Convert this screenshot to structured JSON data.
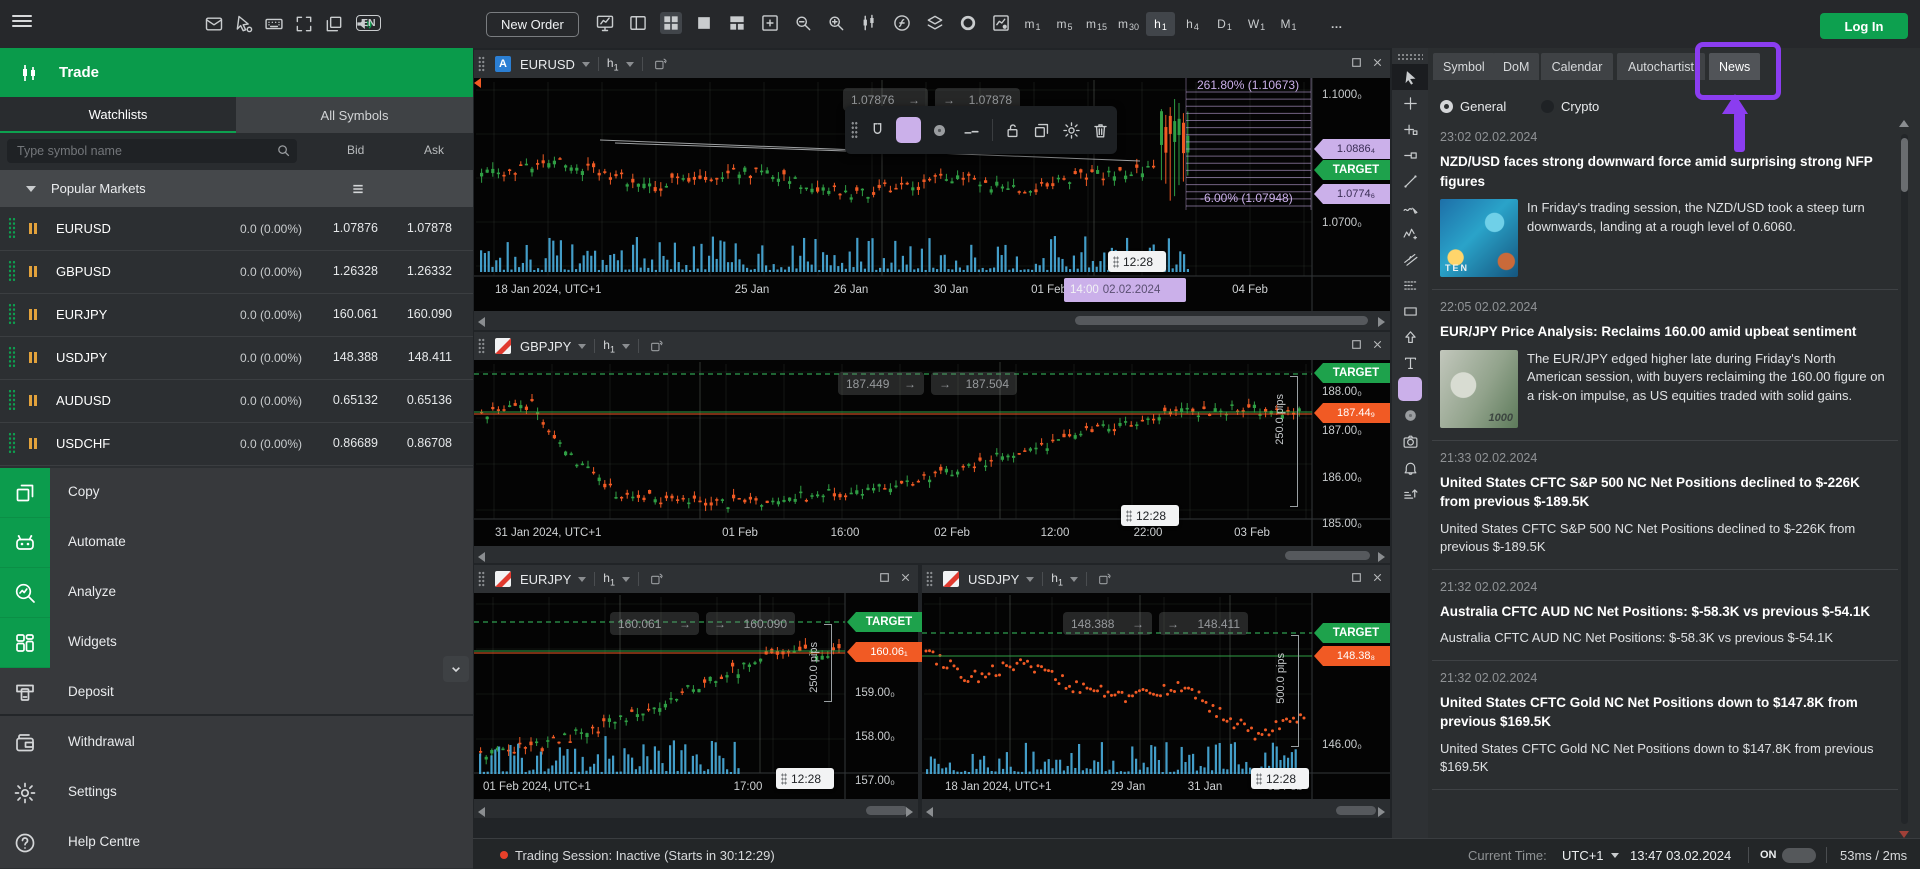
{
  "topbar": {
    "new_order_label": "New Order",
    "language": "EN",
    "login_label": "Log In",
    "more_label": "…",
    "timeframes": [
      {
        "u": "m",
        "s": "1"
      },
      {
        "u": "m",
        "s": "5"
      },
      {
        "u": "m",
        "s": "15"
      },
      {
        "u": "m",
        "s": "30"
      },
      {
        "u": "h",
        "s": "1"
      },
      {
        "u": "h",
        "s": "4"
      },
      {
        "u": "D",
        "s": "1"
      },
      {
        "u": "W",
        "s": "1"
      },
      {
        "u": "M",
        "s": "1"
      }
    ],
    "active_timeframe": "h1"
  },
  "sidebar": {
    "title": "Trade",
    "tab_watchlists": "Watchlists",
    "tab_all_symbols": "All Symbols",
    "search_placeholder": "Type symbol name",
    "col_bid": "Bid",
    "col_ask": "Ask",
    "group_label": "Popular Markets",
    "symbols": [
      {
        "name": "EURUSD",
        "change": "0.0 (0.00%)",
        "bid": "1.07876",
        "ask": "1.07878"
      },
      {
        "name": "GBPUSD",
        "change": "0.0 (0.00%)",
        "bid": "1.26328",
        "ask": "1.26332"
      },
      {
        "name": "EURJPY",
        "change": "0.0 (0.00%)",
        "bid": "160.061",
        "ask": "160.090"
      },
      {
        "name": "USDJPY",
        "change": "0.0 (0.00%)",
        "bid": "148.388",
        "ask": "148.411"
      },
      {
        "name": "AUDUSD",
        "change": "0.0 (0.00%)",
        "bid": "0.65132",
        "ask": "0.65136"
      },
      {
        "name": "USDCHF",
        "change": "0.0 (0.00%)",
        "bid": "0.86689",
        "ask": "0.86708"
      }
    ],
    "menu": [
      {
        "label": "Copy",
        "icon": "copy"
      },
      {
        "label": "Automate",
        "icon": "robot"
      },
      {
        "label": "Analyze",
        "icon": "analyze"
      },
      {
        "label": "Widgets",
        "icon": "widgets"
      }
    ],
    "secondary_menu": [
      {
        "label": "Deposit",
        "icon": "deposit"
      },
      {
        "label": "Withdrawal",
        "icon": "wallet"
      },
      {
        "label": "Settings",
        "icon": "settings"
      },
      {
        "label": "Help Centre",
        "icon": "help"
      }
    ]
  },
  "charts": [
    {
      "symbol": "EURUSD",
      "badge": "A",
      "tf_unit": "h",
      "tf_num": "1",
      "sell": "1.07876",
      "buy": "1.07878",
      "fib_top": "261.80% (1.10673)",
      "fib_bottom": "-6.00% (1.07948)",
      "axis_labels": [
        "1.1000₀",
        "1.0700₀"
      ],
      "tag_upper": "1.0886₄",
      "tag_target": "TARGET",
      "tag_lower": "1.0774₆",
      "time_ticks": [
        "18 Jan 2024, UTC+1",
        "25 Jan",
        "26 Jan",
        "30 Jan",
        "01 Feb",
        "14:00"
      ],
      "time_highlight": "02.02.2024",
      "time_tick_last": "04 Feb",
      "tooltip": "12:28"
    },
    {
      "symbol": "GBPJPY",
      "tf_unit": "h",
      "tf_num": "1",
      "sell": "187.449",
      "buy": "187.504",
      "axis_labels": [
        "188.00₀",
        "187.00₀",
        "186.00₀",
        "185.00₀"
      ],
      "tag_target": "TARGET",
      "tag_price": "187.44₉",
      "pips": "250.0 pips",
      "time_ticks": [
        "31 Jan 2024, UTC+1",
        "01 Feb",
        "16:00",
        "02 Feb",
        "12:00",
        "22:00",
        "03 Feb"
      ],
      "tooltip": "12:28"
    },
    {
      "symbol": "EURJPY",
      "tf_unit": "h",
      "tf_num": "1",
      "sell": "160.061",
      "buy": "160.090",
      "axis_labels": [
        "159.00₀",
        "158.00₀",
        "157.00₀"
      ],
      "tag_target": "TARGET",
      "tag_price": "160.06₁",
      "pips": "250.0 pips",
      "time_ticks": [
        "01 Feb 2024, UTC+1",
        "17:00"
      ],
      "tooltip": "12:28"
    },
    {
      "symbol": "USDJPY",
      "tf_unit": "h",
      "tf_num": "1",
      "sell": "148.388",
      "buy": "148.411",
      "axis_labels": [
        "146.00₀"
      ],
      "tag_target": "TARGET",
      "tag_price": "148.38₈",
      "pips": "500.0 pips",
      "time_ticks": [
        "18 Jan 2024, UTC+1",
        "29 Jan",
        "31 Jan",
        "02 Feb"
      ],
      "tooltip": "12:28"
    }
  ],
  "news": {
    "tabs": [
      {
        "label": "Symbol"
      },
      {
        "label": "DoM"
      },
      {
        "label": "Calendar"
      },
      {
        "label": "Autochartist"
      },
      {
        "label": "News"
      }
    ],
    "active_tab": "News",
    "filter_general": "General",
    "filter_crypto": "Crypto",
    "selected_filter": "General",
    "items": [
      {
        "time": "23:02 02.02.2024",
        "title": "NZD/USD faces strong downward force amid surprising strong NFP figures",
        "body": "In Friday's trading session, the NZD/USD took a steep turn downwards, landing at a rough level of 0.6060.",
        "thumb": "nzd-banknote",
        "thumb_text": "TEN"
      },
      {
        "time": "22:05 02.02.2024",
        "title": "EUR/JPY Price Analysis: Reclaims 160.00 amid upbeat sentiment",
        "body": "The EUR/JPY edged higher late during Friday's North American session, with buyers reclaiming the 160.00 figure on a risk-on impulse, as US equities traded with solid gains.",
        "thumb": "jpy-banknote",
        "thumb_text": "1000"
      },
      {
        "time": "21:33 02.02.2024",
        "title": "United States CFTC S&P 500 NC Net Positions declined to $-226K from previous $-189.5K",
        "body": "United States CFTC S&P 500 NC Net Positions declined to $-226K from previous $-189.5K"
      },
      {
        "time": "21:32 02.02.2024",
        "title": "Australia CFTC AUD NC Net Positions: $-58.3K vs previous $-54.1K",
        "body": "Australia CFTC AUD NC Net Positions: $-58.3K vs previous $-54.1K"
      },
      {
        "time": "21:32 02.02.2024",
        "title": "United States CFTC Gold NC Net Positions down to $147.8K from previous $169.5K",
        "body": "United States CFTC Gold NC Net Positions down to $147.8K from previous $169.5K"
      }
    ]
  },
  "statusbar": {
    "session": "Trading Session: Inactive (Starts in 30:12:29)",
    "current_time_label": "Current Time:",
    "timezone": "UTC+1",
    "datetime": "13:47 03.02.2024",
    "toggle_label": "ON",
    "latency": "53ms / 2ms"
  },
  "icons": {
    "topbar_left": [
      "mail",
      "pointer-settings",
      "virtual-keyboard",
      "fullscreen",
      "duplicate-window",
      "sound"
    ],
    "chart_tools": [
      "chart-monitor",
      "page-layout",
      "grid-2x2",
      "single-view",
      "split-view",
      "add-chart",
      "zoom-out",
      "zoom-in",
      "indicators",
      "functions",
      "layers",
      "object-visibility",
      "chart-settings"
    ],
    "draw_toolbar": [
      "magnet",
      "color-swatch",
      "dot-style",
      "line-style",
      "lock",
      "duplicate",
      "settings",
      "delete"
    ],
    "side_toolbar": [
      "cursor",
      "crosshair",
      "crosshair-sync",
      "anchor-point",
      "trend-line",
      "freehand-draw",
      "elliott-wave",
      "parallel-channel",
      "fibonacci",
      "rectangle",
      "arrow-up",
      "text",
      "color-swatch",
      "brush",
      "camera",
      "alerts",
      "z-order"
    ]
  },
  "colors": {
    "accent_green": "#0da04f",
    "candle_up": "#2f9e44",
    "candle_down": "#f05a24",
    "volume_blue": "#4aaede",
    "lavender": "#cbb0ea",
    "annotation_purple": "#8b3df0",
    "target_green": "#1ea24c",
    "current_price_orange": "#f15a24"
  }
}
